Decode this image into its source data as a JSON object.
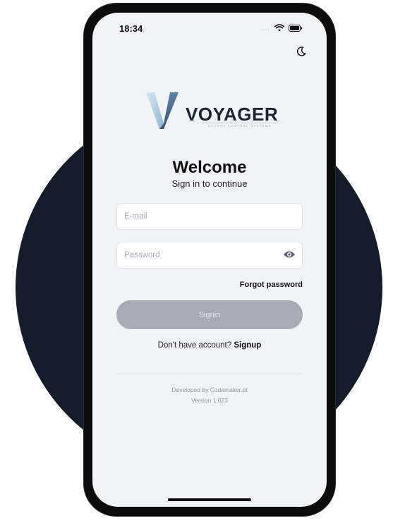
{
  "status_bar": {
    "time": "18:34",
    "signal": "....",
    "wifi_icon": "wifi-icon",
    "battery_icon": "battery-icon"
  },
  "header": {
    "theme_toggle_icon": "moon-icon"
  },
  "logo": {
    "name": "VOYAGER",
    "tagline": "ACCESS CONTROL SYSTEMS",
    "mark_colors": [
      "#6e8fb0",
      "#b8d2e6"
    ]
  },
  "welcome": {
    "title": "Welcome",
    "subtitle": "Sign in to continue"
  },
  "form": {
    "email_placeholder": "E-mail",
    "email_value": "",
    "password_placeholder": "Password",
    "password_value": "",
    "password_visibility_icon": "eye-icon",
    "forgot_password_label": "Forgot password",
    "signin_label": "Signin",
    "signup_prompt": "Don't have account?",
    "signup_label": "Signup"
  },
  "footer": {
    "developer": "Developed by Codemaker.pt",
    "version": "Version 1.023"
  },
  "colors": {
    "background_circle": "#141b2b",
    "screen_background": "#f2f3f7",
    "button_disabled": "#a7abb3",
    "text_primary": "#111111"
  }
}
